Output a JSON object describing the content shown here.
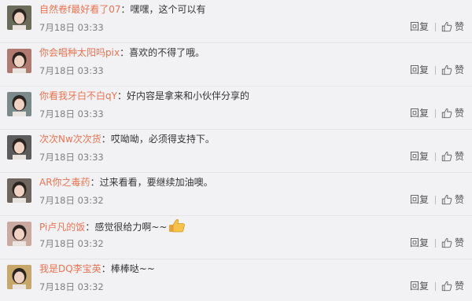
{
  "comments": [
    {
      "user": "自然卷f最好看了07",
      "text": "嘿嘿，这个可以有",
      "time": "7月18日 03:33",
      "reply": "回复",
      "like": "赞",
      "avatar_color": "#6b6b5a"
    },
    {
      "user": "你会唱种太阳吗pix",
      "text": "喜欢的不得了哦。",
      "time": "7月18日 03:33",
      "reply": "回复",
      "like": "赞",
      "avatar_color": "#b07a70"
    },
    {
      "user": "你看我牙白不白qY",
      "text": "好内容是拿来和小伙伴分享的",
      "time": "7月18日 03:33",
      "reply": "回复",
      "like": "赞",
      "avatar_color": "#7a8a8a"
    },
    {
      "user": "次次Nw次次货",
      "text": "哎呦呦，必须得支持下。",
      "time": "7月18日 03:33",
      "reply": "回复",
      "like": "赞",
      "avatar_color": "#5c5c5c"
    },
    {
      "user": "AR你之毒药",
      "text": "过来看看，要继续加油噢。",
      "time": "7月18日 03:32",
      "reply": "回复",
      "like": "赞",
      "avatar_color": "#6e665e"
    },
    {
      "user": "Pi卢凡的饭",
      "text": "感觉很给力啊~~",
      "time": "7月18日 03:32",
      "reply": "回复",
      "like": "赞",
      "avatar_color": "#c9a9a0",
      "emoji": "thumbs-up"
    },
    {
      "user": "我是DQ李宝英",
      "text": "棒棒哒~~",
      "time": "7月18日 03:32",
      "reply": "回复",
      "like": "赞",
      "avatar_color": "#c8a86a"
    }
  ],
  "colors": {
    "username": "#eb7350",
    "text": "#333333",
    "time": "#808080",
    "background": "#f2f2f5"
  },
  "icons": {
    "like": "thumbs-up-icon",
    "emoji": "thumbs-up-emoji"
  }
}
